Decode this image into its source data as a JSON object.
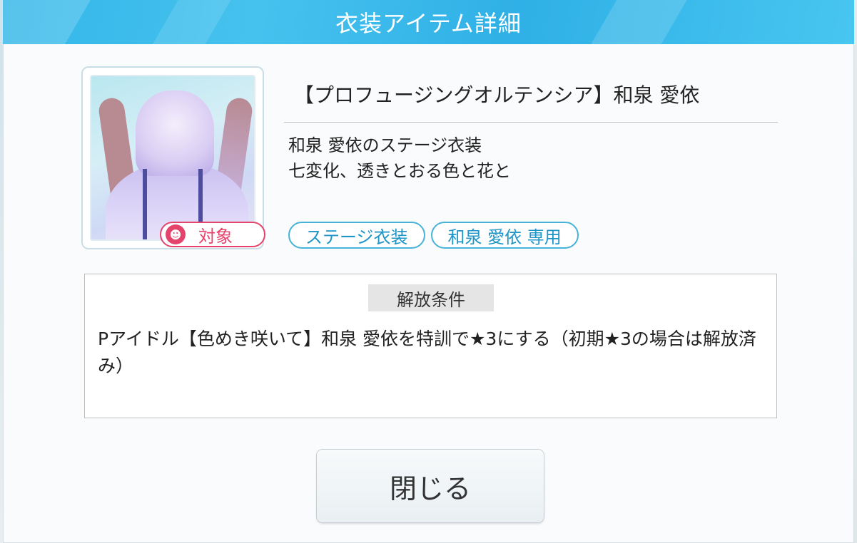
{
  "header": {
    "title": "衣装アイテム詳細"
  },
  "item": {
    "name": "【プロフュージングオルテンシア】和泉 愛依",
    "description": [
      "和泉 愛依のステージ衣装",
      "七変化、透きとおる色と花と"
    ],
    "badge": {
      "label": "対象",
      "icon": "target-person-icon",
      "color": "#e4436b"
    },
    "tags": [
      "ステージ衣装",
      "和泉 愛依 専用"
    ]
  },
  "unlock": {
    "title": "解放条件",
    "text": "Pアイドル【色めき咲いて】和泉 愛依を特訓で★3にする（初期★3の場合は解放済み）"
  },
  "buttons": {
    "close_label": "閉じる"
  },
  "colors": {
    "header": "#32b6e8",
    "tag_border": "#48b3d8",
    "badge": "#e4436b"
  }
}
